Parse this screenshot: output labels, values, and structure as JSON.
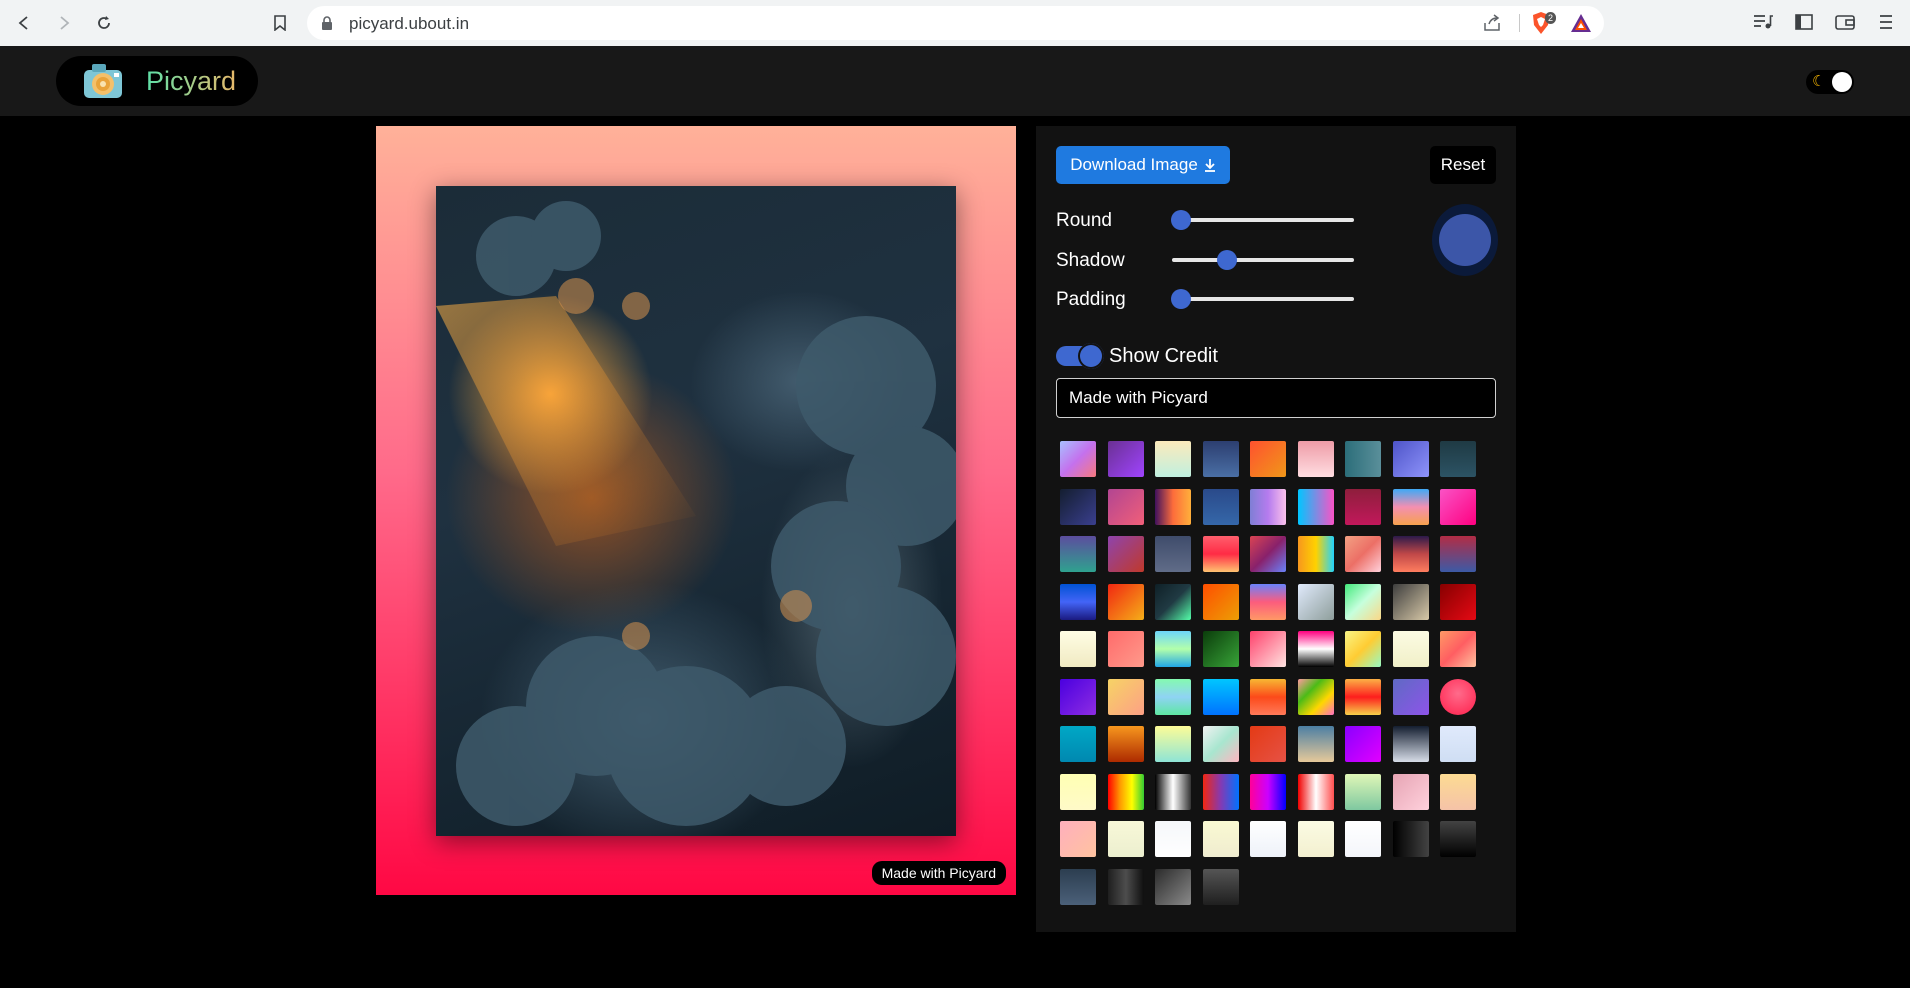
{
  "browser": {
    "url": "picyard.ubout.in",
    "brave_badge_count": "2"
  },
  "header": {
    "title": "Picyard"
  },
  "canvas": {
    "credit_text": "Made with Picyard"
  },
  "panel": {
    "download_label": "Download Image",
    "reset_label": "Reset",
    "sliders": [
      {
        "label": "Round",
        "value": 0.05
      },
      {
        "label": "Shadow",
        "value": 0.3
      },
      {
        "label": "Padding",
        "value": 0.05
      }
    ],
    "selected_color": "#3c56a8",
    "show_credit_label": "Show Credit",
    "show_credit_on": true,
    "credit_input_value": "Made with Picyard"
  },
  "swatches": [
    "linear-gradient(135deg,#a8c0ff,#c471ed,#f7797d)",
    "linear-gradient(135deg,#6a3093,#a044ff)",
    "linear-gradient(180deg,#fceabb,#c0f0e0)",
    "linear-gradient(180deg,#2c3e70,#4a6fa5)",
    "linear-gradient(135deg,#ff512f,#f09819)",
    "linear-gradient(180deg,#ee9ca7,#ffdde1)",
    "linear-gradient(90deg,#2c6e7a,#5a8f9a)",
    "linear-gradient(135deg,#4e54c8,#8f94fb)",
    "linear-gradient(180deg,#1f3a44,#2c5364)",
    "linear-gradient(135deg,#141e30,#3a3f8f)",
    "linear-gradient(135deg,#b24592,#f15f79)",
    "linear-gradient(90deg,#40115e,#fd6c3b,#ffb03b)",
    "linear-gradient(180deg,#2a4a8a,#3567a9)",
    "linear-gradient(90deg,#7f7fd5,#b57bee,#fbc2eb)",
    "linear-gradient(90deg,#00c6ff,#f953c6)",
    "linear-gradient(180deg,#8e1e3c,#c2185b)",
    "linear-gradient(180deg,#3fa9f5,#f48fb1,#f6a14e)",
    "linear-gradient(135deg,#f953c6,#ff0080)",
    "linear-gradient(180deg,#5c4d9e,#2fa28f)",
    "linear-gradient(135deg,#8e44ad,#c0392b)",
    "linear-gradient(180deg,#3f4c6b,#606c88)",
    "linear-gradient(180deg,#ff5f6d,#ff2b45,#ffc371)",
    "linear-gradient(135deg,#da4453,#89216b,#6a82fb)",
    "linear-gradient(90deg,#f7971e,#ffd200,#21d4fd)",
    "linear-gradient(135deg,#f3a183,#ec6f66,#ffd1dc)",
    "linear-gradient(180deg,#2c1a4a,#c04848,#ff7e5f)",
    "linear-gradient(180deg,#b22c45,#3c5aa6)",
    "linear-gradient(180deg,#0052d4,#4364f7,#1a1a80)",
    "linear-gradient(135deg,#f12711,#f5af19)",
    "linear-gradient(135deg,#0f2027,#203a43,#5fa)",
    "linear-gradient(135deg,#ff4e00,#ec9f05)",
    "linear-gradient(180deg,#6a82fb,#fc5c7d,#ff9966)",
    "linear-gradient(135deg,#e0eafc,#8e9e9b)",
    "linear-gradient(135deg,#43e97b,#c6ffdd,#fbd786)",
    "linear-gradient(135deg,#3e3e3e,#d8c9a8)",
    "linear-gradient(135deg,#870000,#e50914)",
    "linear-gradient(180deg,#fffde4,#f0eac2)",
    "linear-gradient(135deg,#ff6b6b,#ff9a8b)",
    "linear-gradient(180deg,#6dd5fa,#b3ffab,#21a7e6)",
    "linear-gradient(135deg,#0b3d0b,#38a438)",
    "linear-gradient(135deg,#ff416c,#ffe4e1)",
    "linear-gradient(180deg,#ff0080,#ffffff,#000000)",
    "linear-gradient(135deg,#f9f586,#ffcc33,#96fbc4)",
    "linear-gradient(180deg,#fcfbe3,#f1f0c8)",
    "linear-gradient(135deg,#ff9966,#ff5e62,#ffc3a0)",
    "linear-gradient(135deg,#4a00e0,#8e2de2)",
    "linear-gradient(135deg,#f6d365,#fda085)",
    "linear-gradient(180deg,#84fab0,#8fd3f4,#5ee7a2)",
    "linear-gradient(180deg,#00c6ff,#0072ff)",
    "linear-gradient(180deg,#f7b733,#fc4a1a,#ff7a59)",
    "linear-gradient(135deg,#ff9a9e,#4cbb17,#ffd700,#ff6ec4)",
    "linear-gradient(180deg,#fcb045,#fd1d1d,#f7d14a)",
    "linear-gradient(135deg,#5f6ac4,#8e54e9)",
    "radial-gradient(circle at 50% 40%,#ff6b8b,#ff1f4b)",
    "linear-gradient(180deg,#00a8c6,#0088b0)",
    "linear-gradient(180deg,#f7971e,#ad2a00)",
    "linear-gradient(180deg,#fdfc97,#8ee4d6)",
    "linear-gradient(135deg,#f2f2f2,#a8e6cf,#ffb6c1)",
    "linear-gradient(135deg,#e43a15,#e65245)",
    "linear-gradient(180deg,#4c7fa3,#e6c99a)",
    "linear-gradient(135deg,#8a00ff,#e100ff)",
    "linear-gradient(180deg,#141e30,#d7dde8)",
    "linear-gradient(180deg,#e0eafc,#cfdef3)",
    "linear-gradient(180deg,#ffffb3,#fffac8)",
    "linear-gradient(90deg,#ff0000,#ff9900,#ffff00,#33cc33)",
    "linear-gradient(90deg,#000000,#ffffff,#333333)",
    "linear-gradient(90deg,#f12711,#833ab4,#0072ff)",
    "linear-gradient(90deg,#ff0099,#cc00ff,#0000ff)",
    "linear-gradient(90deg,#f00000,#ffffff,#ff4f4f)",
    "linear-gradient(180deg,#e0f7b7,#7ec8a0)",
    "linear-gradient(135deg,#e6a4b4,#ffd1dc)",
    "linear-gradient(180deg,#fddb92,#f5c3a8)",
    "linear-gradient(135deg,#ffafbd,#ffc3a0)",
    "linear-gradient(180deg,#f8f8d8,#ecefcf)",
    "linear-gradient(180deg,#f5f7fa,#ffffff)",
    "linear-gradient(180deg,#fafad2,#f0ecd0)",
    "linear-gradient(180deg,#ffffff,#eef2f9)",
    "linear-gradient(180deg,#fbfbe3,#f3f0d0)",
    "linear-gradient(180deg,#ffffff,#f4f6fb)",
    "linear-gradient(90deg,#000000,#434343)",
    "linear-gradient(180deg,#434343,#000000)",
    "linear-gradient(180deg,#2c3e50,#4b6079)",
    "linear-gradient(90deg,#1f1f1f,#4d4d4d,#0f0f0f)",
    "linear-gradient(135deg,#2b2b2b,#8a8a8a)",
    "linear-gradient(180deg,#555555,#1f1f1f)"
  ]
}
